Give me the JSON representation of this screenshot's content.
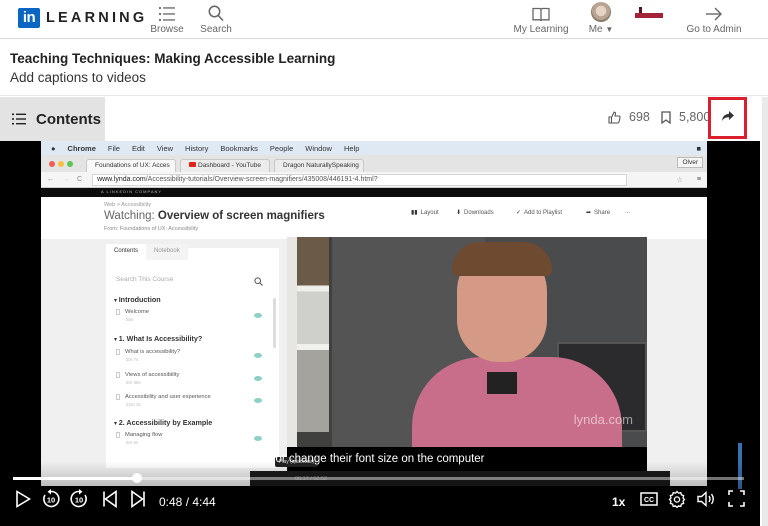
{
  "nav": {
    "brand_box": "in",
    "brand_text": "LEARNING",
    "items": [
      {
        "label": "Browse",
        "icon": "list-icon"
      },
      {
        "label": "Search",
        "icon": "search-icon"
      },
      {
        "label": "My Learning",
        "icon": "book-icon"
      },
      {
        "label": "Me",
        "icon": "avatar"
      },
      {
        "label": "Go to Admin",
        "icon": "arrow-right-icon"
      }
    ]
  },
  "course": {
    "title": "Teaching Techniques: Making Accessible Learning",
    "subtitle": "Add captions to videos"
  },
  "toolbar": {
    "contents_label": "Contents",
    "likes": "698",
    "saves": "5,800",
    "highlight_color": "#d9202c"
  },
  "screen": {
    "menubar": [
      "Chrome",
      "File",
      "Edit",
      "View",
      "History",
      "Bookmarks",
      "People",
      "Window",
      "Help"
    ],
    "tabs": [
      "Foundations of UX: Acces",
      "Dashboard - YouTube",
      "Dragon NaturallySpeaking"
    ],
    "other_button": "Olver",
    "url_host": "www.lynda.com",
    "url_path": "/Accessibility-tutorials/Overview-screen-magnifiers/435008/446191-4.html?",
    "strip_text": "A LINKEDIN COMPANY",
    "breadcrumb": "Web  >  Accessibility",
    "watching_prefix": "Watching: ",
    "watching_title": "Overview of screen magnifiers",
    "from": "From: Foundations of UX: Accessibility",
    "actions": [
      "Layout",
      "Downloads",
      "Add to Playlist",
      "Share",
      "..."
    ],
    "panel_tabs": [
      "Contents",
      "Notebook"
    ],
    "panel_search_placeholder": "Search This Course",
    "sections": [
      {
        "title": "Introduction",
        "lessons": [
          {
            "title": "Welcome",
            "duration": "55s"
          }
        ]
      },
      {
        "title": "1. What Is Accessibility?",
        "lessons": [
          {
            "title": "What is accessibility?",
            "duration": "3m 7s"
          },
          {
            "title": "Views of accessibility",
            "duration": "5m 38s"
          },
          {
            "title": "Accessibility and user experience",
            "duration": "12m 3s"
          }
        ]
      },
      {
        "title": "2. Accessibility by Example",
        "lessons": [
          {
            "title": "Managing flow",
            "duration": "5m 6s"
          }
        ]
      }
    ],
    "watermark": "lynda.com",
    "tooltip": "Play (spacebar)",
    "inner_time": "00:17 / 02:52"
  },
  "player": {
    "caption": "or change their font size on the computer",
    "current_time": "0:48",
    "duration": "4:44",
    "time_display": "0:48 / 4:44",
    "progress_fraction": 0.169,
    "speed": "1x",
    "skip_back_seconds": "10",
    "skip_forward_seconds": "10"
  }
}
